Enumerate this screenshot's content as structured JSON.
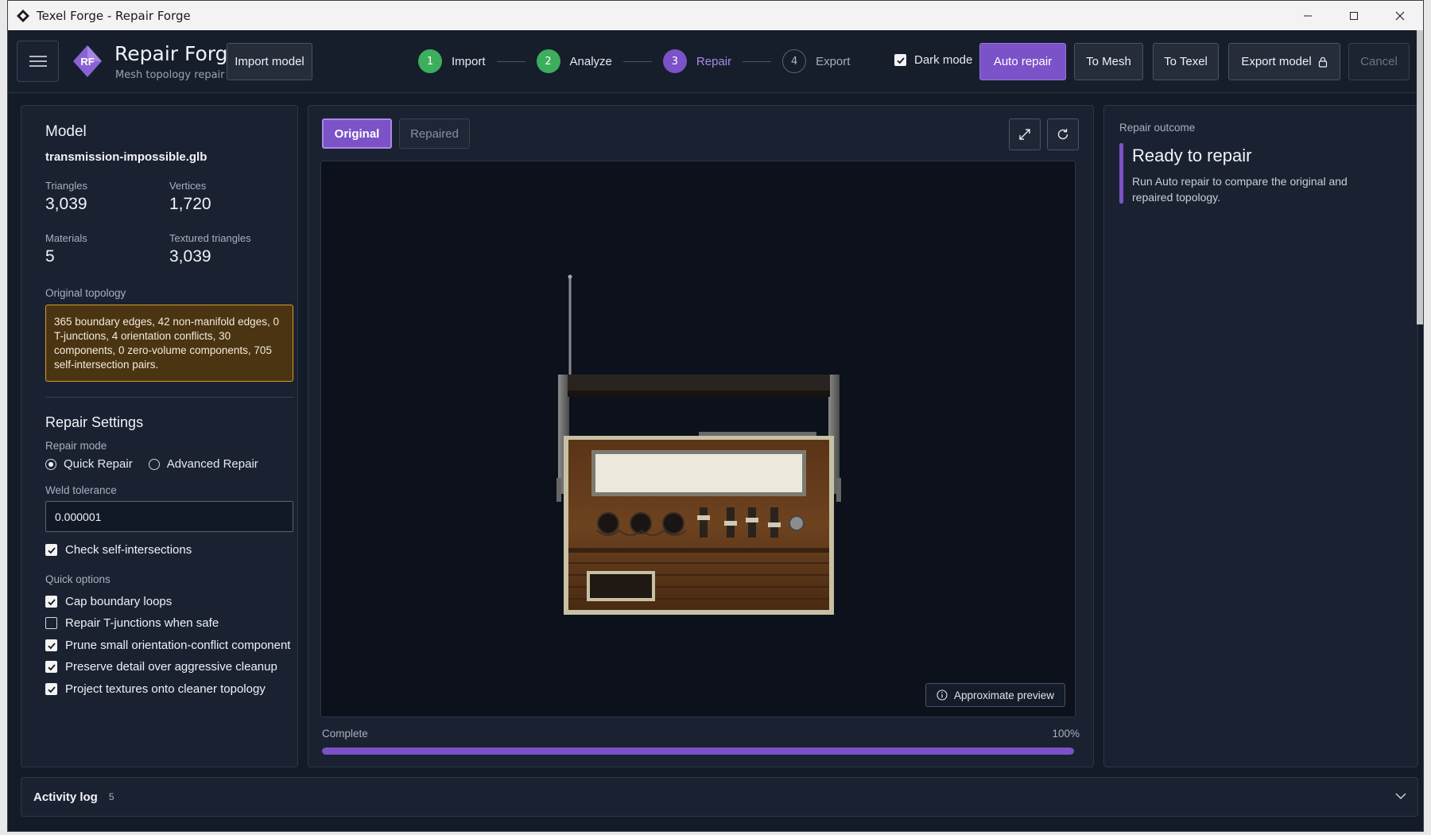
{
  "window": {
    "title": "Texel Forge - Repair Forge"
  },
  "brand": {
    "title": "Repair Forge",
    "subtitle": "Mesh topology repair",
    "logo_text": "RF",
    "accent": "#7b52c7"
  },
  "toolbar": {
    "import_label": "Import model",
    "steps": [
      {
        "num": "1",
        "label": "Import",
        "state": "done"
      },
      {
        "num": "2",
        "label": "Analyze",
        "state": "done"
      },
      {
        "num": "3",
        "label": "Repair",
        "state": "active"
      },
      {
        "num": "4",
        "label": "Export",
        "state": "pending"
      }
    ],
    "dark_mode_label": "Dark mode",
    "dark_mode_checked": true,
    "auto_repair_label": "Auto repair",
    "to_mesh_label": "To Mesh",
    "to_texel_label": "To Texel",
    "export_label": "Export model",
    "cancel_label": "Cancel"
  },
  "model": {
    "heading": "Model",
    "filename": "transmission-impossible.glb",
    "stats": [
      {
        "label": "Triangles",
        "value": "3,039"
      },
      {
        "label": "Vertices",
        "value": "1,720"
      },
      {
        "label": "Materials",
        "value": "5"
      },
      {
        "label": "Textured triangles",
        "value": "3,039"
      }
    ],
    "topology_label": "Original topology",
    "topology_text": "365 boundary edges, 42 non-manifold edges, 0 T-junctions, 4 orientation conflicts, 30 components, 0 zero-volume components, 705 self-intersection pairs."
  },
  "settings": {
    "heading": "Repair Settings",
    "mode_label": "Repair mode",
    "mode_options": [
      "Quick Repair",
      "Advanced Repair"
    ],
    "mode_selected": "Quick Repair",
    "weld_label": "Weld tolerance",
    "weld_value": "0.000001",
    "check_self_label": "Check self-intersections",
    "quick_options_label": "Quick options",
    "quick_options": [
      {
        "label": "Cap boundary loops",
        "checked": true
      },
      {
        "label": "Repair T-junctions when safe",
        "checked": false
      },
      {
        "label": "Prune small orientation-conflict component",
        "checked": true
      },
      {
        "label": "Preserve detail over aggressive cleanup",
        "checked": true
      },
      {
        "label": "Project textures onto cleaner topology",
        "checked": true
      }
    ]
  },
  "viewer": {
    "tab_original": "Original",
    "tab_repaired": "Repaired",
    "approx_label": "Approximate preview",
    "progress_label": "Complete",
    "progress_text": "100%",
    "progress_value": 1.0
  },
  "outcome": {
    "label": "Repair outcome",
    "title": "Ready to repair",
    "text": "Run Auto repair to compare the original and repaired topology."
  },
  "activity": {
    "title": "Activity log",
    "count": "5"
  }
}
